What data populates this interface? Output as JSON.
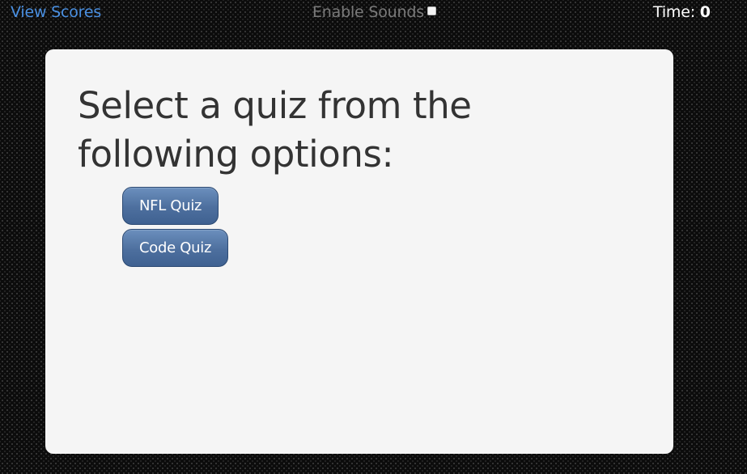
{
  "topbar": {
    "view_scores_label": "View Scores",
    "sounds_label": "Enable Sounds",
    "sounds_enabled": false,
    "time_label": "Time:",
    "time_value": "0"
  },
  "main": {
    "heading": "Select a quiz from the following options:",
    "quizzes": [
      {
        "label": "NFL Quiz"
      },
      {
        "label": "Code Quiz"
      }
    ]
  },
  "colors": {
    "link": "#4a90e2",
    "card_background": "#f5f5f5",
    "button_gradient_top": "#6b8fbd",
    "button_gradient_bottom": "#3f6191",
    "page_background": "#0c0c0c"
  }
}
